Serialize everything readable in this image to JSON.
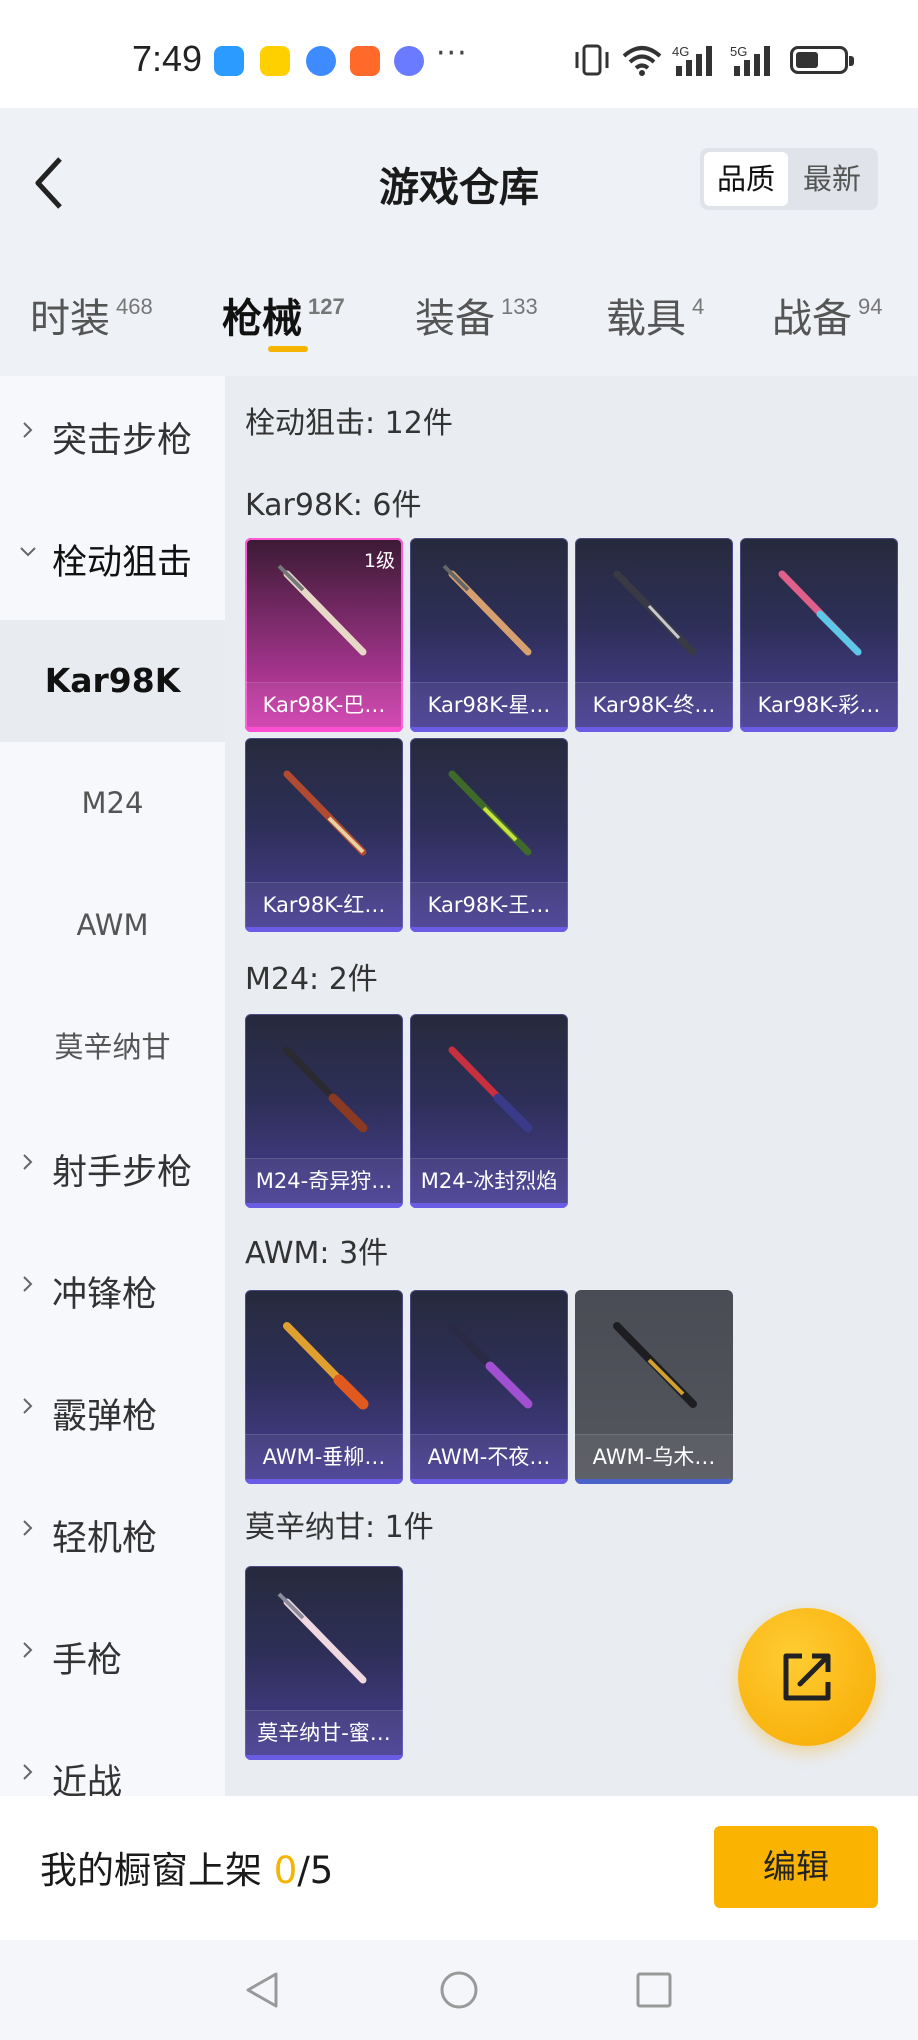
{
  "status_bar": {
    "time": "7:49",
    "more": "···",
    "network_1": "4G",
    "network_2": "5G",
    "colors": {
      "app1": "#2c9bff",
      "app2": "#ffd000",
      "app3": "#3d8bff",
      "app4": "#ff6a2a",
      "app5": "#6a7bff"
    }
  },
  "header": {
    "title": "游戏仓库",
    "sort_options": [
      "品质",
      "最新"
    ],
    "sort_selected": "品质"
  },
  "tabs": [
    {
      "label": "时装",
      "count": "468"
    },
    {
      "label": "枪械",
      "count": "127"
    },
    {
      "label": "装备",
      "count": "133"
    },
    {
      "label": "载具",
      "count": "4"
    },
    {
      "label": "战备",
      "count": "94"
    }
  ],
  "active_tab": "枪械",
  "sidebar": {
    "categories": [
      "突击步枪",
      "栓动狙击",
      "射手步枪",
      "冲锋枪",
      "霰弹枪",
      "轻机枪",
      "手枪",
      "近战"
    ],
    "subcategories": [
      "Kar98K",
      "M24",
      "AWM",
      "莫辛纳甘"
    ],
    "active_sub": "Kar98K"
  },
  "main": {
    "section_title": "栓动狙击: 12件",
    "groups": [
      {
        "title": "Kar98K: 6件",
        "items": [
          {
            "name": "Kar98K-巴…",
            "level": "1级",
            "tier": "pink"
          },
          {
            "name": "Kar98K-星…",
            "tier": "purple"
          },
          {
            "name": "Kar98K-终…",
            "tier": "purple"
          },
          {
            "name": "Kar98K-彩…",
            "tier": "purple"
          },
          {
            "name": "Kar98K-红…",
            "tier": "purple"
          },
          {
            "name": "Kar98K-王…",
            "tier": "purple"
          }
        ]
      },
      {
        "title": "M24: 2件",
        "items": [
          {
            "name": "M24-奇异狩…",
            "tier": "purple"
          },
          {
            "name": "M24-冰封烈焰",
            "tier": "purple"
          }
        ]
      },
      {
        "title": "AWM: 3件",
        "items": [
          {
            "name": "AWM-垂柳…",
            "tier": "purple"
          },
          {
            "name": "AWM-不夜…",
            "tier": "purple"
          },
          {
            "name": "AWM-乌木…",
            "tier": "gray"
          }
        ]
      },
      {
        "title": "莫辛纳甘: 1件",
        "items": [
          {
            "name": "莫辛纳甘-蜜…",
            "tier": "purple"
          }
        ]
      }
    ]
  },
  "bottom": {
    "showcase_label": "我的橱窗上架",
    "showcase_count": "0",
    "showcase_total": "/5",
    "edit_button": "编辑"
  },
  "colors": {
    "accent": "#f5b400",
    "tier_pink": "#d43fb2",
    "tier_purple": "#4a3f96",
    "tier_gray": "#55575f"
  }
}
